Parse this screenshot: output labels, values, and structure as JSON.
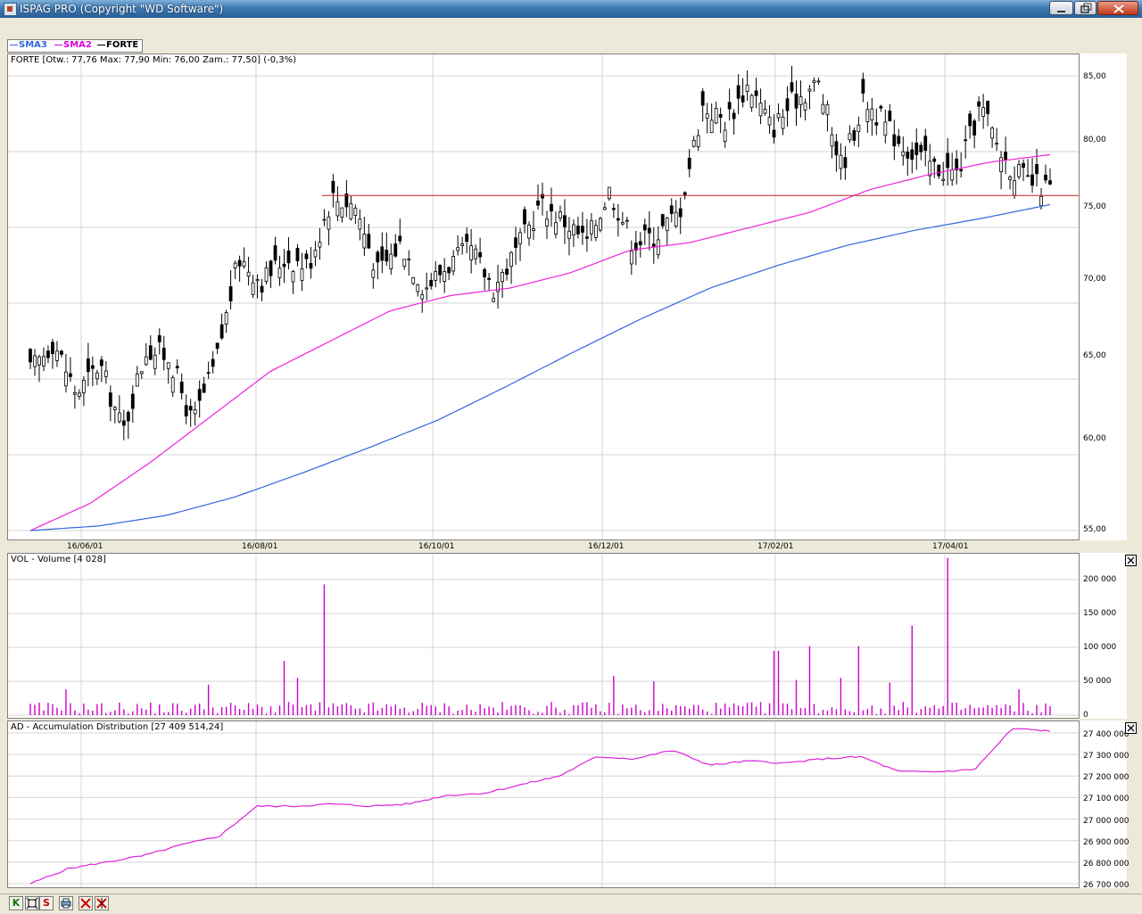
{
  "window": {
    "title": "ISPAG PRO (Copyright \"WD Software\")"
  },
  "legend": [
    {
      "label": "SMA3",
      "color": "#3366dd"
    },
    {
      "label": "SMA2",
      "color": "#dd00dd"
    },
    {
      "label": "FORTE",
      "color": "#000000"
    }
  ],
  "price_panel": {
    "label": "FORTE [Otw.: 77,76  Max: 77,90  Min: 76,00  Zam.: 77,50] (-0,3%)",
    "ticks": [
      "85,00",
      "80,00",
      "75,00",
      "70,00",
      "65,00",
      "60,00",
      "55,00"
    ]
  },
  "dates": [
    "16/06/01",
    "16/08/01",
    "16/10/01",
    "16/12/01",
    "17/02/01",
    "17/04/01"
  ],
  "volume_panel": {
    "label": "VOL - Volume [4 028]",
    "ticks": [
      "200 000",
      "150 000",
      "100 000",
      "50 000",
      "0"
    ]
  },
  "ad_panel": {
    "label": "AD - Accumulation Distribution [27 409 514,24]",
    "ticks": [
      "27 400 000",
      "27 300 000",
      "27 200 000",
      "27 100 000",
      "27 000 000",
      "26 900 000",
      "26 800 000",
      "26 700 000"
    ]
  },
  "toolbar": {
    "buttons": [
      {
        "label": "K",
        "icon": "k-icon"
      },
      {
        "label": "",
        "icon": "zoom-fit-icon"
      },
      {
        "label": "S",
        "icon": "s-icon"
      },
      {
        "label": "",
        "icon": "print-icon"
      },
      {
        "label": "",
        "icon": "delete-icon"
      },
      {
        "label": "",
        "icon": "delete-all-icon"
      }
    ]
  },
  "colors": {
    "sma3": "#3366dd",
    "sma2": "#ee22dd",
    "candles": "#000000",
    "volume": "#cc00cc",
    "ad": "#dd22dd",
    "resistance": "#cc2222",
    "grid": "#d4d4d4"
  },
  "chart_data": [
    {
      "type": "candlestick",
      "title": "FORTE [Otw.: 77,76  Max: 77,90  Min: 76,00  Zam.: 77,50] (-0,3%)",
      "x_ticks": [
        "16/06/01",
        "16/08/01",
        "16/10/01",
        "16/12/01",
        "17/02/01",
        "17/04/01"
      ],
      "ylim": [
        54.5,
        86.5
      ],
      "y_ticks": [
        55,
        60,
        65,
        70,
        75,
        80,
        85
      ],
      "close_samples": [
        65.5,
        67.5,
        64.0,
        66.0,
        61.5,
        67.0,
        66.5,
        62.0,
        66.0,
        73.0,
        71.5,
        73.0,
        72.5,
        77.0,
        76.5,
        72.0,
        74.0,
        71.0,
        72.5,
        73.5,
        71.0,
        73.5,
        76.5,
        75.5,
        74.0,
        77.5,
        74.0,
        74.5,
        76.0,
        83.0,
        82.0,
        84.5,
        81.5,
        83.5,
        84.5,
        79.0,
        83.5,
        81.5,
        80.0,
        79.0,
        78.5,
        83.0,
        79.5,
        78.0,
        77.5
      ],
      "series": [
        {
          "name": "SMA3",
          "values": [
            55.0,
            55.3,
            56.0,
            57.2,
            58.8,
            60.5,
            62.3,
            64.5,
            66.8,
            69.0,
            71.0,
            72.5,
            73.8,
            74.8,
            75.6,
            76.5
          ]
        },
        {
          "name": "SMA2",
          "values": [
            55.0,
            56.8,
            59.5,
            62.5,
            65.5,
            67.5,
            69.5,
            70.5,
            71.0,
            72.0,
            73.5,
            74.0,
            75.0,
            76.0,
            77.5,
            78.5,
            79.3,
            79.8
          ]
        },
        {
          "name": "FORTE",
          "values": [
            65.5,
            67.5,
            64.0,
            66.0,
            61.5,
            67.0,
            66.5,
            62.0,
            66.0,
            73.0,
            71.5,
            73.0,
            72.5,
            77.0,
            76.5,
            72.0,
            74.0,
            71.0,
            72.5,
            73.5,
            71.0,
            73.5,
            76.5,
            75.5,
            74.0,
            77.5,
            74.0,
            74.5,
            76.0,
            83.0,
            82.0,
            84.5,
            81.5,
            83.5,
            84.5,
            79.0,
            83.5,
            81.5,
            80.0,
            79.0,
            78.5,
            83.0,
            79.5,
            78.0,
            77.5
          ]
        }
      ],
      "resistance_line": 77.1,
      "grid": true
    },
    {
      "type": "bar",
      "title": "VOL - Volume [4 028]",
      "ylim": [
        0,
        240000
      ],
      "y_ticks": [
        0,
        50000,
        100000,
        150000,
        200000
      ],
      "spikes": [
        38000,
        45000,
        80000,
        55000,
        193000,
        58000,
        50000,
        95000,
        55000,
        102000,
        102000,
        48000,
        132000,
        95000,
        52000,
        232000,
        38000,
        32000
      ],
      "grid": true
    },
    {
      "type": "line",
      "title": "AD - Accumulation Distribution [27 409 514,24]",
      "ylim": [
        26690000,
        27440000
      ],
      "y_ticks": [
        26700000,
        26800000,
        26900000,
        27000000,
        27100000,
        27200000,
        27300000,
        27400000
      ],
      "values": [
        26700000,
        26770000,
        26800000,
        26830000,
        26880000,
        26920000,
        27060000,
        27060000,
        27070000,
        27060000,
        27070000,
        27110000,
        27120000,
        27160000,
        27200000,
        27290000,
        27280000,
        27320000,
        27250000,
        27270000,
        27260000,
        27280000,
        27290000,
        27220000,
        27220000,
        27230000,
        27420000,
        27410000
      ],
      "grid": true
    }
  ]
}
